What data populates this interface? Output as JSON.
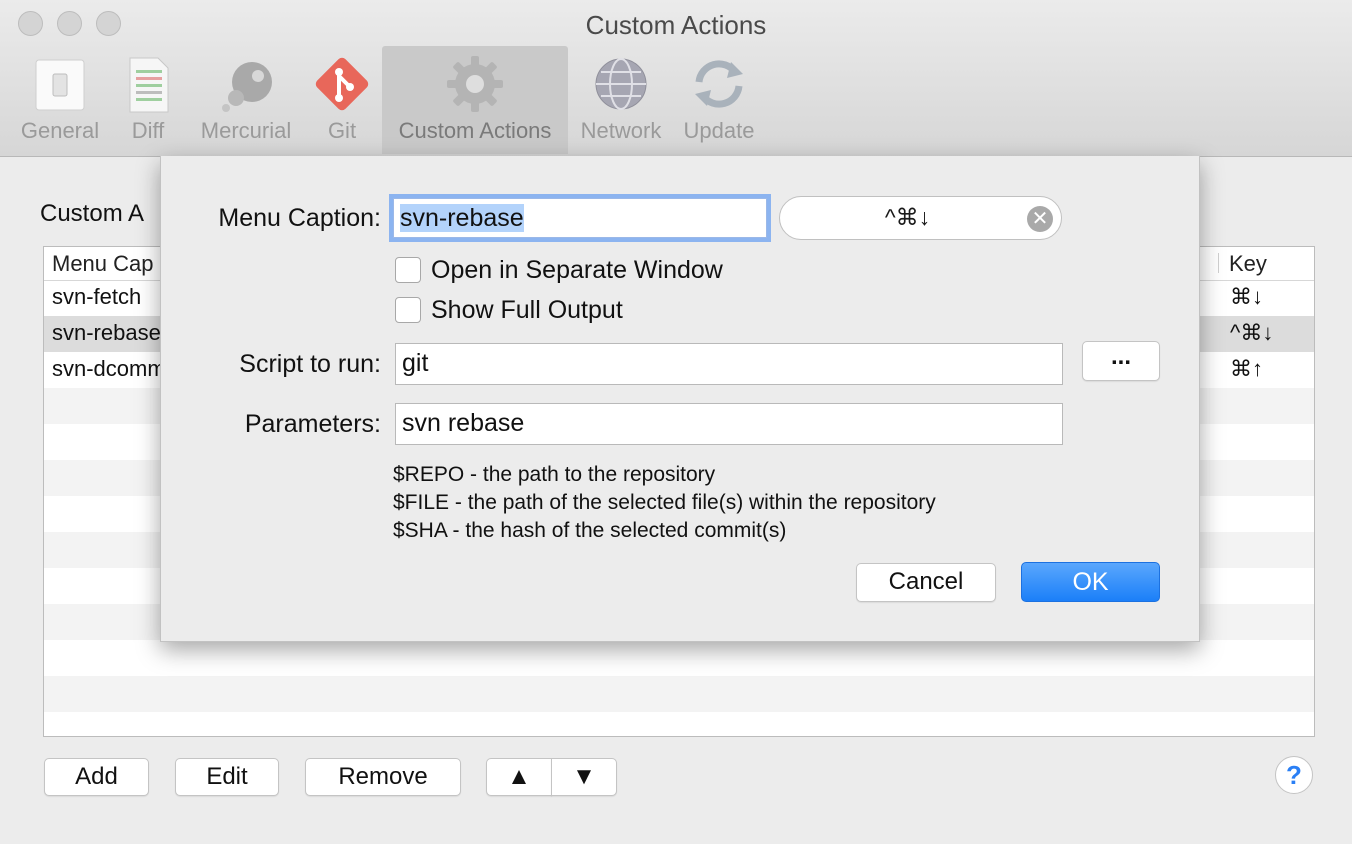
{
  "window": {
    "title": "Custom Actions"
  },
  "toolbar": {
    "items": [
      {
        "label": "General",
        "icon": "general-switch-icon"
      },
      {
        "label": "Diff",
        "icon": "diff-document-icon"
      },
      {
        "label": "Mercurial",
        "icon": "mercurial-icon"
      },
      {
        "label": "Git",
        "icon": "git-icon"
      },
      {
        "label": "Custom Actions",
        "icon": "gear-icon",
        "active": true
      },
      {
        "label": "Network",
        "icon": "globe-icon"
      },
      {
        "label": "Update",
        "icon": "refresh-icon"
      }
    ]
  },
  "section": {
    "title": "Custom A"
  },
  "table": {
    "headers": {
      "caption": "Menu Cap",
      "key": "Key"
    },
    "rows": [
      {
        "caption": "svn-fetch",
        "key": "⌘↓"
      },
      {
        "caption": "svn-rebase",
        "key": "^⌘↓",
        "selected": true
      },
      {
        "caption": "svn-dcomm",
        "key": "⌘↑"
      }
    ]
  },
  "buttons": {
    "add": "Add",
    "edit": "Edit",
    "remove": "Remove",
    "up": "▲",
    "down": "▼",
    "help": "?"
  },
  "dialog": {
    "menu_caption_label": "Menu Caption:",
    "menu_caption_value": "svn-rebase",
    "shortcut": "^⌘↓",
    "open_separate_window": "Open in Separate Window",
    "show_full_output": "Show Full Output",
    "script_label": "Script to run:",
    "script_value": "git",
    "browse_button": "...",
    "parameters_label": "Parameters:",
    "parameters_value": "svn rebase",
    "hints": [
      "$REPO - the path to the repository",
      "$FILE - the path of the selected file(s) within the repository",
      "$SHA - the hash of the selected commit(s)"
    ],
    "cancel": "Cancel",
    "ok": "OK"
  },
  "colors": {
    "accent": "#1b7ff8",
    "selection": "#b3d3fb",
    "git": "#e8675a"
  }
}
